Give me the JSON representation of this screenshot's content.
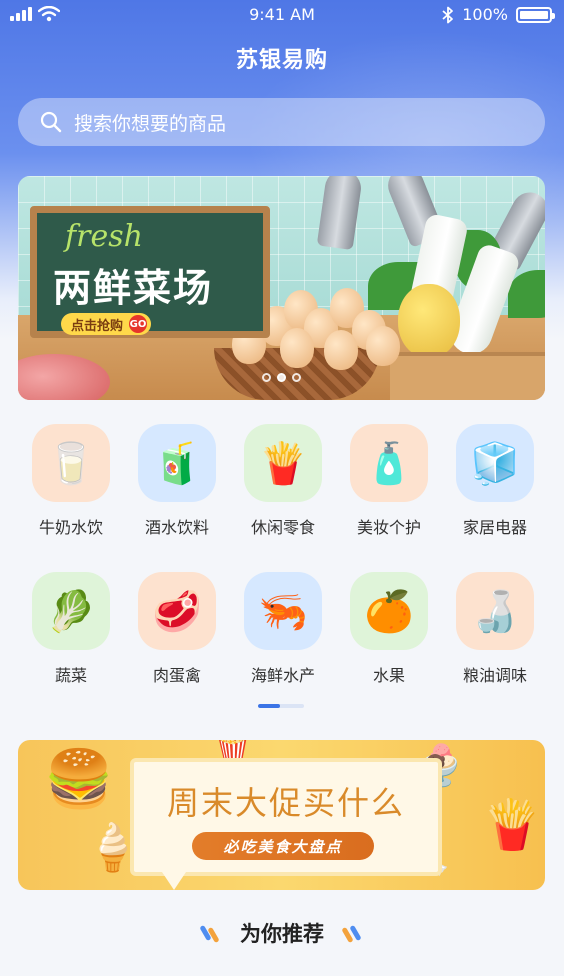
{
  "status_bar": {
    "time": "9:41 AM",
    "battery": "100%"
  },
  "app": {
    "title": "苏银易购"
  },
  "search": {
    "placeholder": "搜索你想要的商品"
  },
  "banner": {
    "tag": "fresh",
    "title": "两鲜菜场",
    "cta": "点击抢购",
    "badge": "GO",
    "page_count": 3,
    "active_page": 2
  },
  "categories": [
    {
      "label": "牛奶水饮",
      "icon": "milk-icon",
      "glyph": "🥛",
      "bg": "#fde2cf"
    },
    {
      "label": "酒水饮料",
      "icon": "drinks-icon",
      "glyph": "🧃",
      "bg": "#d6e8ff"
    },
    {
      "label": "休闲零食",
      "icon": "snacks-icon",
      "glyph": "🍟",
      "bg": "#dff4d9"
    },
    {
      "label": "美妆个护",
      "icon": "cosmetics-icon",
      "glyph": "🧴",
      "bg": "#fde2cf"
    },
    {
      "label": "家居电器",
      "icon": "appliance-icon",
      "glyph": "🧊",
      "bg": "#d6e8ff"
    },
    {
      "label": "蔬菜",
      "icon": "vegetable-icon",
      "glyph": "🥬",
      "bg": "#dff4d9"
    },
    {
      "label": "肉蛋禽",
      "icon": "meat-icon",
      "glyph": "🥩",
      "bg": "#fde2cf"
    },
    {
      "label": "海鲜水产",
      "icon": "seafood-icon",
      "glyph": "🦐",
      "bg": "#d6e8ff"
    },
    {
      "label": "水果",
      "icon": "fruit-icon",
      "glyph": "🍊",
      "bg": "#dff4d9"
    },
    {
      "label": "粮油调味",
      "icon": "oil-icon",
      "glyph": "🍶",
      "bg": "#fde2cf"
    }
  ],
  "category_pager": {
    "page": 1,
    "pages": 2
  },
  "promo": {
    "title": "周末大促买什么",
    "subtitle": "必吃美食大盘点"
  },
  "recommend": {
    "title": "为你推荐"
  },
  "colors": {
    "primary": "#4f77e6",
    "accent": "#3b74e6",
    "promo": "#f7c55a"
  }
}
